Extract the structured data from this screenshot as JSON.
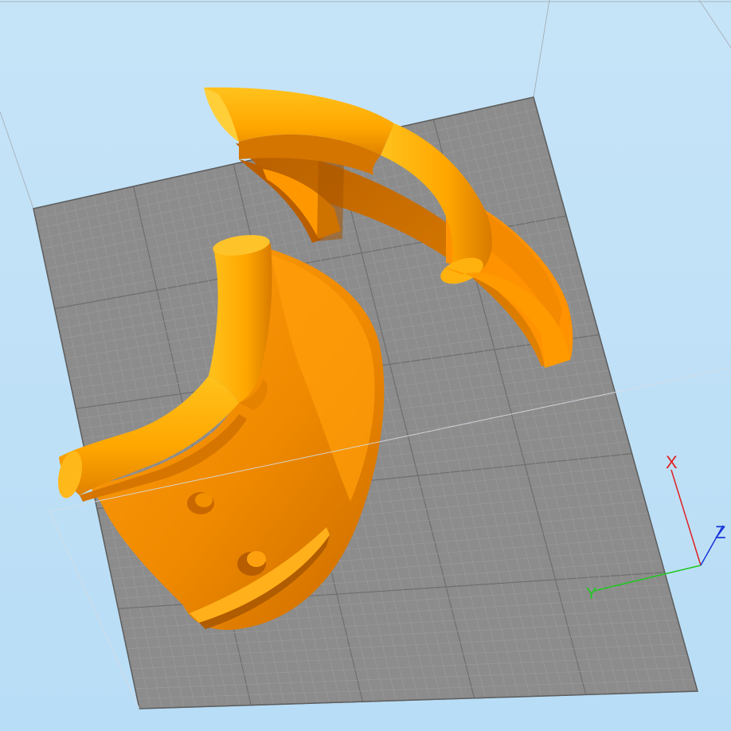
{
  "viewport": {
    "background_top": "#c6e4f8",
    "background_bottom": "#b8ddf6",
    "bed_color": "#8c8c8c",
    "grid_fine_color": "#9a9a9a",
    "grid_major_color": "#6e6e6e",
    "build_volume_color": "#d6dce2"
  },
  "model": {
    "color": "#ff9a00",
    "highlight_color": "#ffbd1a",
    "shadow_color": "#c56a00",
    "parts": [
      "upper-shell-piece",
      "lower-shell-piece"
    ]
  },
  "axes": {
    "x": {
      "label": "X",
      "color": "#e02020"
    },
    "y": {
      "label": "Y",
      "color": "#20c820"
    },
    "z": {
      "label": "Z",
      "color": "#1a36d8"
    }
  }
}
